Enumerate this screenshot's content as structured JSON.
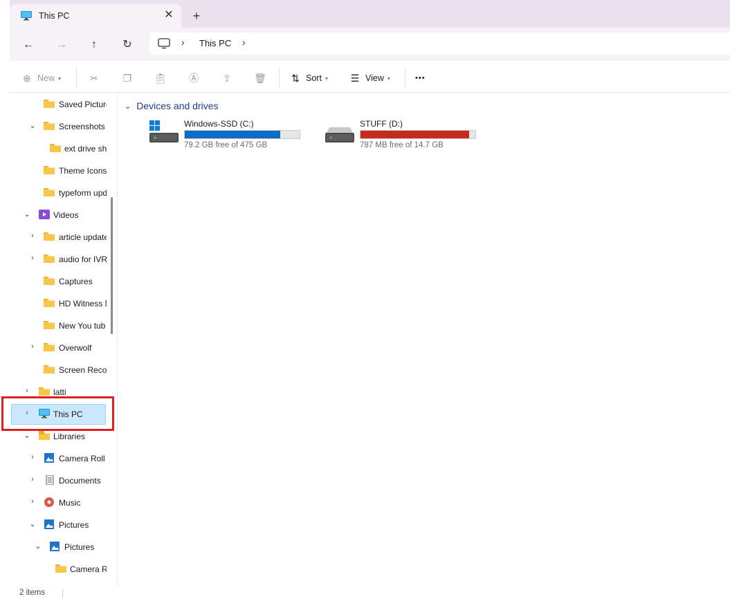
{
  "tab": {
    "title": "This PC",
    "close": "✕",
    "new_tab": "+"
  },
  "nav": {
    "back": "←",
    "forward": "→",
    "up": "↑",
    "refresh": "↻"
  },
  "address": {
    "sep": "›",
    "crumb": "This PC"
  },
  "toolbar": {
    "new_label": "New",
    "sort_label": "Sort",
    "view_label": "View",
    "more": "•••"
  },
  "sidebar": {
    "items": [
      {
        "label": "Saved Pictures",
        "chevron": ""
      },
      {
        "label": "Screenshots",
        "chevron": "⌄"
      },
      {
        "label": "ext drive sh",
        "chevron": ""
      },
      {
        "label": "Theme Icons",
        "chevron": ""
      },
      {
        "label": "typeform upd",
        "chevron": ""
      },
      {
        "label": "Videos",
        "chevron": "⌄"
      },
      {
        "label": "article update",
        "chevron": "›"
      },
      {
        "label": "audio for IVR",
        "chevron": "›"
      },
      {
        "label": "Captures",
        "chevron": ""
      },
      {
        "label": "HD Witness N",
        "chevron": ""
      },
      {
        "label": "New You tub",
        "chevron": ""
      },
      {
        "label": "Overwolf",
        "chevron": "›"
      },
      {
        "label": "Screen Recor",
        "chevron": ""
      },
      {
        "label": "latti",
        "chevron": "›"
      },
      {
        "label": "This PC",
        "chevron": "›"
      },
      {
        "label": "Libraries",
        "chevron": "⌄"
      },
      {
        "label": "Camera Roll",
        "chevron": "›"
      },
      {
        "label": "Documents",
        "chevron": "›"
      },
      {
        "label": "Music",
        "chevron": "›"
      },
      {
        "label": "Pictures",
        "chevron": "⌄"
      },
      {
        "label": "Pictures",
        "chevron": "⌄"
      },
      {
        "label": "Camera R",
        "chevron": ""
      }
    ]
  },
  "content": {
    "group_title": "Devices and drives",
    "drives": [
      {
        "name": "Windows-SSD (C:)",
        "free_text": "79.2 GB free of 475 GB",
        "used_fraction": 0.833,
        "bar_color": "#0f6cc6"
      },
      {
        "name": "STUFF (D:)",
        "free_text": "787 MB free of 14.7 GB",
        "used_fraction": 0.948,
        "bar_color": "#c42b1c"
      }
    ]
  },
  "status": {
    "item_count": "2 items"
  }
}
